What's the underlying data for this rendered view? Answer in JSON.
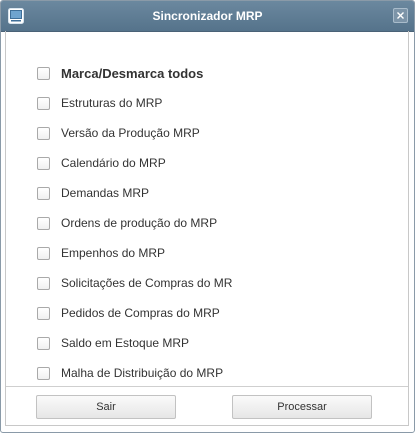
{
  "window": {
    "title": "Sincronizador MRP",
    "icon": "window-app-icon",
    "close_icon": "close-icon",
    "colors": {
      "titlebar": "#5f7d95",
      "title_text": "#ffffff",
      "background": "#ffffff"
    }
  },
  "options": {
    "select_all": {
      "label": "Marca/Desmarca todos",
      "checked": false
    },
    "items": [
      {
        "label": "Estruturas do MRP",
        "checked": false
      },
      {
        "label": "Versão da Produção MRP",
        "checked": false
      },
      {
        "label": "Calendário do MRP",
        "checked": false
      },
      {
        "label": "Demandas MRP",
        "checked": false
      },
      {
        "label": "Ordens de produção do MRP",
        "checked": false
      },
      {
        "label": "Empenhos do MRP",
        "checked": false
      },
      {
        "label": "Solicitações de Compras do MR",
        "checked": false
      },
      {
        "label": "Pedidos de Compras do MRP",
        "checked": false
      },
      {
        "label": "Saldo em Estoque MRP",
        "checked": false
      },
      {
        "label": "Malha de Distribuição do MRP",
        "checked": false
      }
    ]
  },
  "buttons": {
    "exit_label": "Sair",
    "process_label": "Processar"
  }
}
